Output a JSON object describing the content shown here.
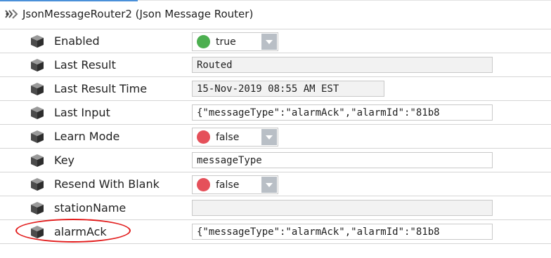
{
  "header": {
    "icon": "link-arrows-icon",
    "title": "JsonMessageRouter2  (Json Message Router)"
  },
  "colors": {
    "true_dot": "#4caf50",
    "false_dot": "#e5505a",
    "accent": "#4a90d9",
    "highlight": "#e21c1c"
  },
  "rows": [
    {
      "icon": "cube-icon",
      "label": "Enabled",
      "type": "toggle",
      "value": "true"
    },
    {
      "icon": "cube-icon",
      "label": "Last Result",
      "type": "text",
      "value": "Routed"
    },
    {
      "icon": "cube-icon",
      "label": "Last Result Time",
      "type": "text",
      "value": "15-Nov-2019 08:55 AM EST"
    },
    {
      "icon": "cube-icon",
      "label": "Last Input",
      "type": "text",
      "value": "{\"messageType\":\"alarmAck\",\"alarmId\":\"81b8"
    },
    {
      "icon": "cube-icon",
      "label": "Learn Mode",
      "type": "toggle",
      "value": "false"
    },
    {
      "icon": "cube-icon",
      "label": "Key",
      "type": "input",
      "value": "messageType"
    },
    {
      "icon": "cube-icon",
      "label": "Resend With Blank",
      "type": "toggle",
      "value": "false"
    },
    {
      "icon": "cube-icon",
      "label": "stationName",
      "type": "text",
      "value": ""
    },
    {
      "icon": "cube-icon",
      "label": "alarmAck",
      "type": "text",
      "value": "{\"messageType\":\"alarmAck\",\"alarmId\":\"81b8"
    }
  ]
}
